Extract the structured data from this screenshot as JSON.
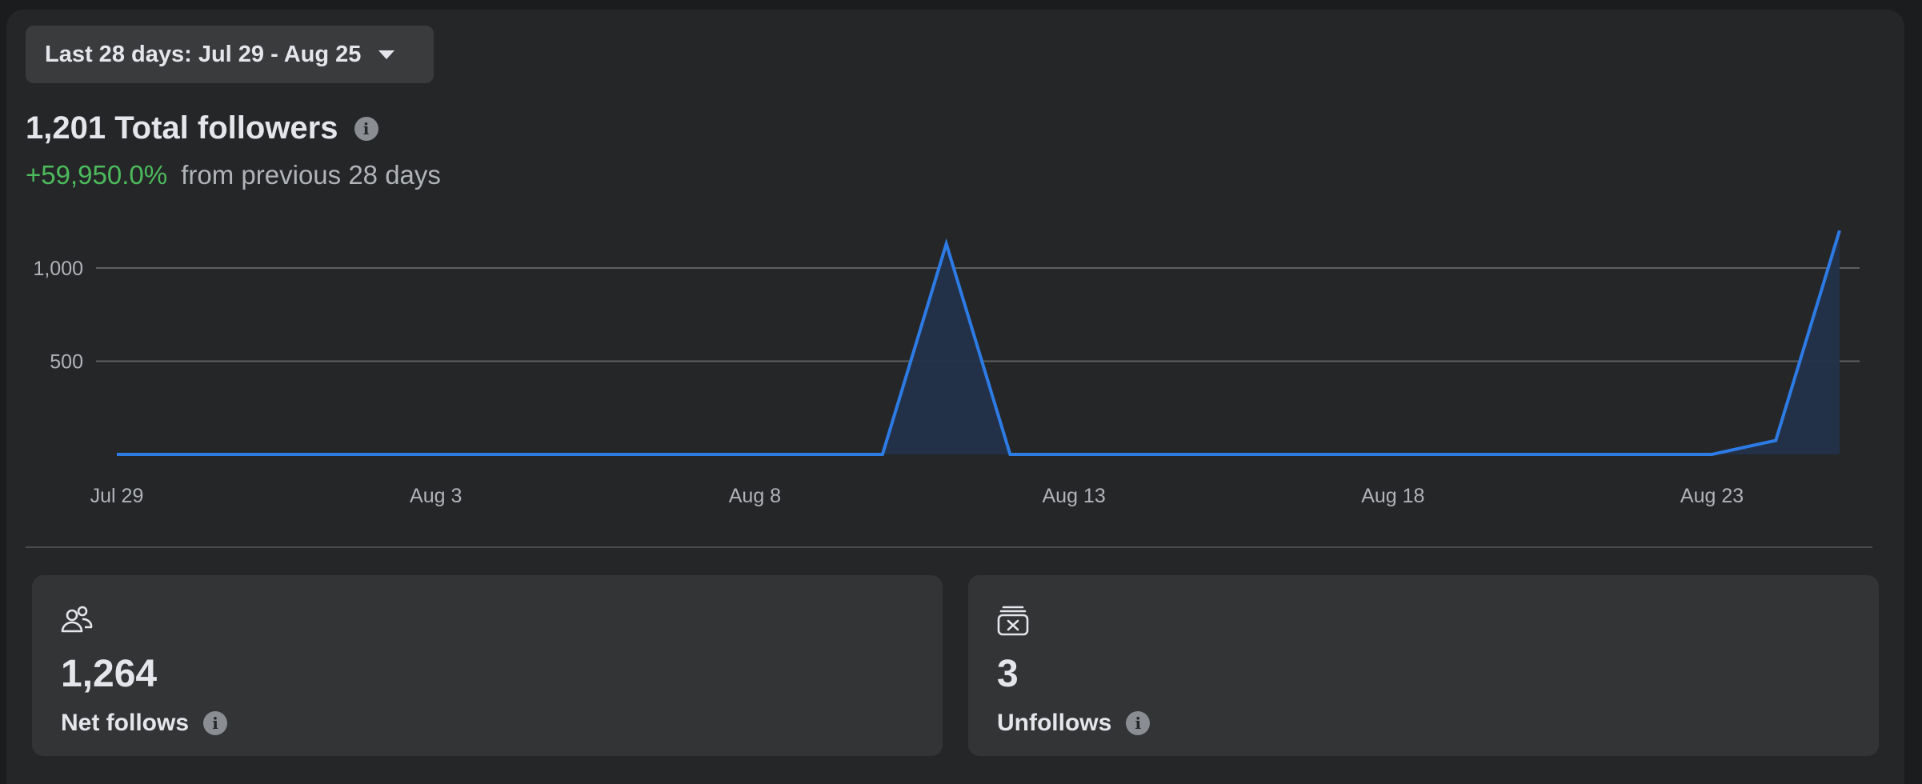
{
  "date_range": {
    "label": "Last 28 days: Jul 29 - Aug 25"
  },
  "summary": {
    "total_followers": "1,201 Total followers",
    "change_pct": "+59,950.0%",
    "change_text": "from previous 28 days",
    "change_color": "#4cbb5c"
  },
  "chart_data": {
    "type": "area",
    "x": [
      "Jul 29",
      "Jul 30",
      "Jul 31",
      "Aug 1",
      "Aug 2",
      "Aug 3",
      "Aug 4",
      "Aug 5",
      "Aug 6",
      "Aug 7",
      "Aug 8",
      "Aug 9",
      "Aug 10",
      "Aug 11",
      "Aug 12",
      "Aug 13",
      "Aug 14",
      "Aug 15",
      "Aug 16",
      "Aug 17",
      "Aug 18",
      "Aug 19",
      "Aug 20",
      "Aug 21",
      "Aug 22",
      "Aug 23",
      "Aug 24",
      "Aug 25"
    ],
    "series": [
      {
        "values": [
          0,
          0,
          0,
          0,
          0,
          0,
          0,
          0,
          0,
          0,
          0,
          0,
          0,
          1130,
          0,
          0,
          0,
          0,
          0,
          0,
          0,
          0,
          0,
          0,
          0,
          0,
          75,
          1201
        ]
      }
    ],
    "x_tick_labels": [
      "Jul 29",
      "Aug 3",
      "Aug 8",
      "Aug 13",
      "Aug 18",
      "Aug 23"
    ],
    "y_ticks": [
      500,
      1000
    ],
    "y_tick_labels": [
      "500",
      "1,000"
    ],
    "ylim": [
      0,
      1000
    ],
    "grid": true,
    "line_color": "#2d7be5"
  },
  "cards": [
    {
      "icon": "people-icon",
      "value": "1,264",
      "label": "Net follows"
    },
    {
      "icon": "unfollow-icon",
      "value": "3",
      "label": "Unfollows"
    }
  ]
}
